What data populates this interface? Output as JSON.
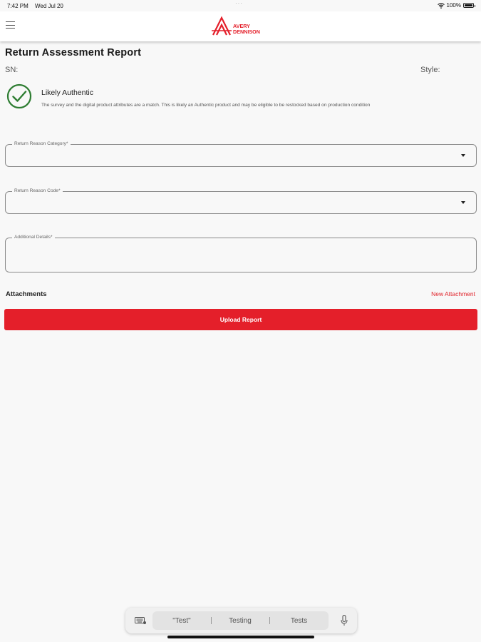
{
  "status_bar": {
    "time": "7:42 PM",
    "date": "Wed Jul 20",
    "battery": "100%"
  },
  "header": {
    "logo_line1": "AVERY",
    "logo_line2": "DENNISON",
    "brand_color": "#e41f2a"
  },
  "page": {
    "title": "Return Assessment Report",
    "sn_label": "SN:",
    "style_label": "Style:"
  },
  "authenticity": {
    "status": "Likely Authentic",
    "description": "The survey and the digital product attributes are a match. This is likely an Authentic product and may be eligible to be restocked based on production condition",
    "icon": "check-circle-icon",
    "color": "#2e7d32"
  },
  "form": {
    "return_reason_category": {
      "label": "Return Reason Category*",
      "value": ""
    },
    "return_reason_code": {
      "label": "Return Reason Code*",
      "value": ""
    },
    "additional_details": {
      "label": "Additional Details*",
      "value": ""
    }
  },
  "attachments": {
    "label": "Attachments",
    "new_label": "New Attachment"
  },
  "upload_button": "Upload Report",
  "keyboard_bar": {
    "suggestions": [
      "\"Test\"",
      "Testing",
      "Tests"
    ]
  }
}
